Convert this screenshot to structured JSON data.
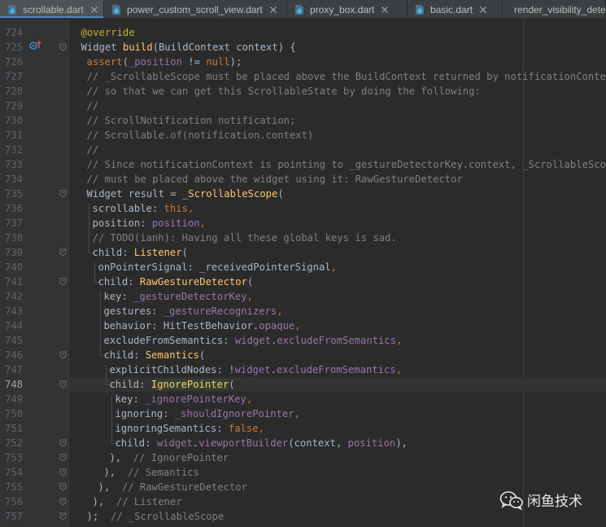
{
  "tabs": [
    {
      "label": "scrollable.dart",
      "active": true
    },
    {
      "label": "power_custom_scroll_view.dart",
      "active": false
    },
    {
      "label": "proxy_box.dart",
      "active": false
    },
    {
      "label": "basic.dart",
      "active": false
    },
    {
      "label": "render_visibility_dete",
      "active": false
    }
  ],
  "current_line": "748",
  "lines": [
    {
      "n": "724",
      "t": [
        [
          "ann",
          "@override"
        ]
      ]
    },
    {
      "n": "725",
      "t": [
        [
          "",
          "Widget "
        ],
        [
          "cls",
          "build"
        ],
        [
          "",
          "(BuildContext context) {"
        ]
      ]
    },
    {
      "n": "726",
      "t": [
        [
          "kw",
          "assert"
        ],
        [
          "",
          "("
        ],
        [
          "fld",
          "_position"
        ],
        [
          "",
          " != "
        ],
        [
          "kw",
          "null"
        ],
        [
          "",
          ");"
        ]
      ]
    },
    {
      "n": "727",
      "t": [
        [
          "cmt",
          "// _ScrollableScope must be placed above the BuildContext returned by notificationContext"
        ]
      ]
    },
    {
      "n": "728",
      "t": [
        [
          "cmt",
          "// so that we can get this ScrollableState by doing the following:"
        ]
      ]
    },
    {
      "n": "729",
      "t": [
        [
          "cmt",
          "//"
        ]
      ]
    },
    {
      "n": "730",
      "t": [
        [
          "cmt",
          "// ScrollNotification notification;"
        ]
      ]
    },
    {
      "n": "731",
      "t": [
        [
          "cmt",
          "// Scrollable.of(notification.context)"
        ]
      ]
    },
    {
      "n": "732",
      "t": [
        [
          "cmt",
          "//"
        ]
      ]
    },
    {
      "n": "733",
      "t": [
        [
          "cmt",
          "// Since notificationContext is pointing to _gestureDetectorKey.context, _ScrollableScope"
        ]
      ]
    },
    {
      "n": "734",
      "t": [
        [
          "cmt",
          "// must be placed above the widget using it: RawGestureDetector"
        ]
      ]
    },
    {
      "n": "735",
      "t": [
        [
          "",
          "Widget result = "
        ],
        [
          "cls",
          "_ScrollableScope"
        ],
        [
          "",
          "("
        ]
      ]
    },
    {
      "n": "736",
      "t": [
        [
          "",
          "scrollable: "
        ],
        [
          "kw",
          "this,"
        ]
      ]
    },
    {
      "n": "737",
      "t": [
        [
          "",
          "position: "
        ],
        [
          "fld",
          "position"
        ],
        [
          "kw",
          ","
        ]
      ]
    },
    {
      "n": "738",
      "t": [
        [
          "cmt",
          "// TODO(ianh): Having all these global keys is sad."
        ]
      ]
    },
    {
      "n": "739",
      "t": [
        [
          "",
          "child: "
        ],
        [
          "cls",
          "Listener"
        ],
        [
          "",
          "("
        ]
      ]
    },
    {
      "n": "740",
      "t": [
        [
          "",
          "onPointerSignal: _receivedPointerSignal"
        ],
        [
          "kw",
          ","
        ]
      ]
    },
    {
      "n": "741",
      "t": [
        [
          "",
          "child: "
        ],
        [
          "cls",
          "RawGestureDetector"
        ],
        [
          "",
          "("
        ]
      ]
    },
    {
      "n": "742",
      "t": [
        [
          "",
          "key: "
        ],
        [
          "fld",
          "_gestureDetectorKey"
        ],
        [
          "kw",
          ","
        ]
      ]
    },
    {
      "n": "743",
      "t": [
        [
          "",
          "gestures: "
        ],
        [
          "fld",
          "_gestureRecognizers"
        ],
        [
          "kw",
          ","
        ]
      ]
    },
    {
      "n": "744",
      "t": [
        [
          "",
          "behavior: HitTestBehavior."
        ],
        [
          "fld",
          "opaque"
        ],
        [
          "kw",
          ","
        ]
      ]
    },
    {
      "n": "745",
      "t": [
        [
          "",
          "excludeFromSemantics: "
        ],
        [
          "fld",
          "widget"
        ],
        [
          "",
          "."
        ],
        [
          "fld",
          "excludeFromSemantics"
        ],
        [
          "kw",
          ","
        ]
      ]
    },
    {
      "n": "746",
      "t": [
        [
          "",
          "child: "
        ],
        [
          "cls",
          "Semantics"
        ],
        [
          "",
          "("
        ]
      ]
    },
    {
      "n": "747",
      "t": [
        [
          "",
          "explicitChildNodes: !"
        ],
        [
          "fld",
          "widget"
        ],
        [
          "",
          "."
        ],
        [
          "fld",
          "excludeFromSemantics"
        ],
        [
          "kw",
          ","
        ]
      ]
    },
    {
      "n": "748",
      "t": [
        [
          "",
          "child: "
        ],
        [
          "hl",
          "IgnorePointer"
        ],
        [
          "",
          "("
        ]
      ]
    },
    {
      "n": "749",
      "t": [
        [
          "",
          "key: "
        ],
        [
          "fld",
          "_ignorePointerKey"
        ],
        [
          "kw",
          ","
        ]
      ]
    },
    {
      "n": "750",
      "t": [
        [
          "",
          "ignoring: "
        ],
        [
          "fld",
          "_shouldIgnorePointer"
        ],
        [
          "kw",
          ","
        ]
      ]
    },
    {
      "n": "751",
      "t": [
        [
          "",
          "ignoringSemantics: "
        ],
        [
          "kw",
          "false,"
        ]
      ]
    },
    {
      "n": "752",
      "t": [
        [
          "",
          "child: "
        ],
        [
          "fld",
          "widget"
        ],
        [
          "",
          "."
        ],
        [
          "fld",
          "viewportBuilder"
        ],
        [
          "",
          "(context, "
        ],
        [
          "fld",
          "position"
        ],
        [
          "",
          "),"
        ]
      ]
    },
    {
      "n": "753",
      "t": [
        [
          "",
          "),  "
        ],
        [
          "cmt",
          "// IgnorePointer"
        ]
      ]
    },
    {
      "n": "754",
      "t": [
        [
          "",
          "),  "
        ],
        [
          "cmt",
          "// Semantics"
        ]
      ]
    },
    {
      "n": "755",
      "t": [
        [
          "",
          "),  "
        ],
        [
          "cmt",
          "// RawGestureDetector"
        ]
      ]
    },
    {
      "n": "756",
      "t": [
        [
          "",
          "),  "
        ],
        [
          "cmt",
          "// Listener"
        ]
      ]
    },
    {
      "n": "757",
      "t": [
        [
          "",
          ");  "
        ],
        [
          "cmt",
          "// _ScrollableScope"
        ]
      ]
    }
  ],
  "watermark": {
    "text": "闲鱼技术"
  },
  "colors": {
    "background": "#2b2b2b",
    "gutter": "#313335",
    "keyword": "#cc7832",
    "annotation": "#bbb529",
    "function": "#ffc66d",
    "field": "#9876aa",
    "comment": "#808080",
    "text": "#a9b7c6",
    "tab_accent": "#4a88c7"
  },
  "icons": {
    "tab_file": "dart-file-icon",
    "tab_close": "close-icon",
    "gutter_override": "override-method-icon",
    "fold": "fold-marker-icon",
    "watermark": "wechat-logo-icon"
  }
}
